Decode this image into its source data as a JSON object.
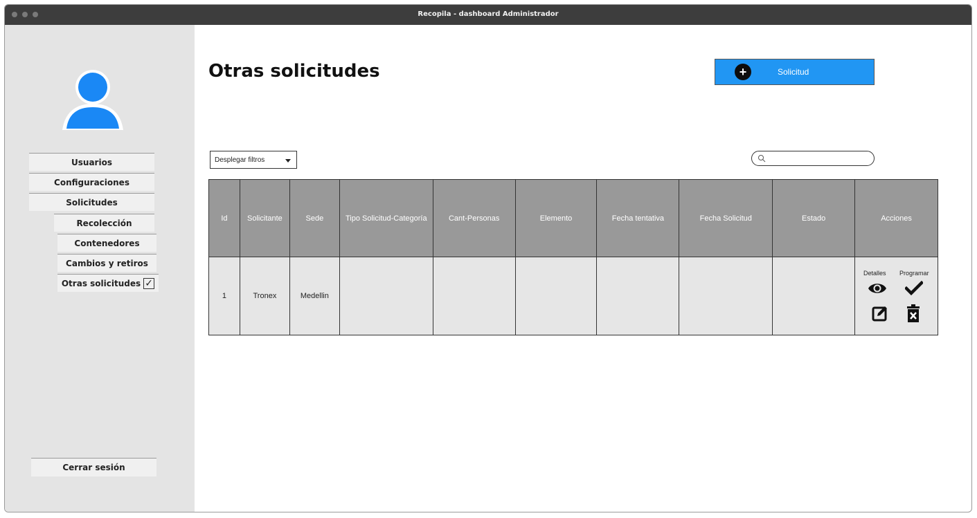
{
  "window": {
    "title": "Recopila - dashboard Administrador"
  },
  "sidebar": {
    "items": [
      {
        "label": "Usuarios"
      },
      {
        "label": "Configuraciones"
      },
      {
        "label": "Solicitudes"
      },
      {
        "label": "Recolección"
      },
      {
        "label": "Contenedores"
      },
      {
        "label": "Cambios y retiros"
      },
      {
        "label": "Otras solicitudes",
        "checked": true,
        "check_mark": "✓"
      }
    ],
    "logout_label": "Cerrar sesión"
  },
  "main": {
    "title": "Otras solicitudes",
    "add_button_label": "Solicitud",
    "add_button_icon": "plus-circle-icon",
    "filter_label": "Desplegar filtros",
    "search_placeholder": "",
    "accent_color": "#2196f3"
  },
  "table": {
    "columns": [
      "Id",
      "Solicitante",
      "Sede",
      "Tipo Solicitud-Categoría",
      "Cant-Personas",
      "Elemento",
      "Fecha tentativa",
      "Fecha Solicitud",
      "Estado",
      "Acciones"
    ],
    "rows": [
      {
        "cells": [
          "1",
          "Tronex",
          "Medellin",
          "",
          "",
          "",
          "",
          "",
          ""
        ],
        "action_labels": {
          "details": "Detalles",
          "schedule": "Programar"
        },
        "action_icons": [
          "eye-icon",
          "check-icon",
          "edit-icon",
          "delete-icon"
        ]
      }
    ]
  }
}
